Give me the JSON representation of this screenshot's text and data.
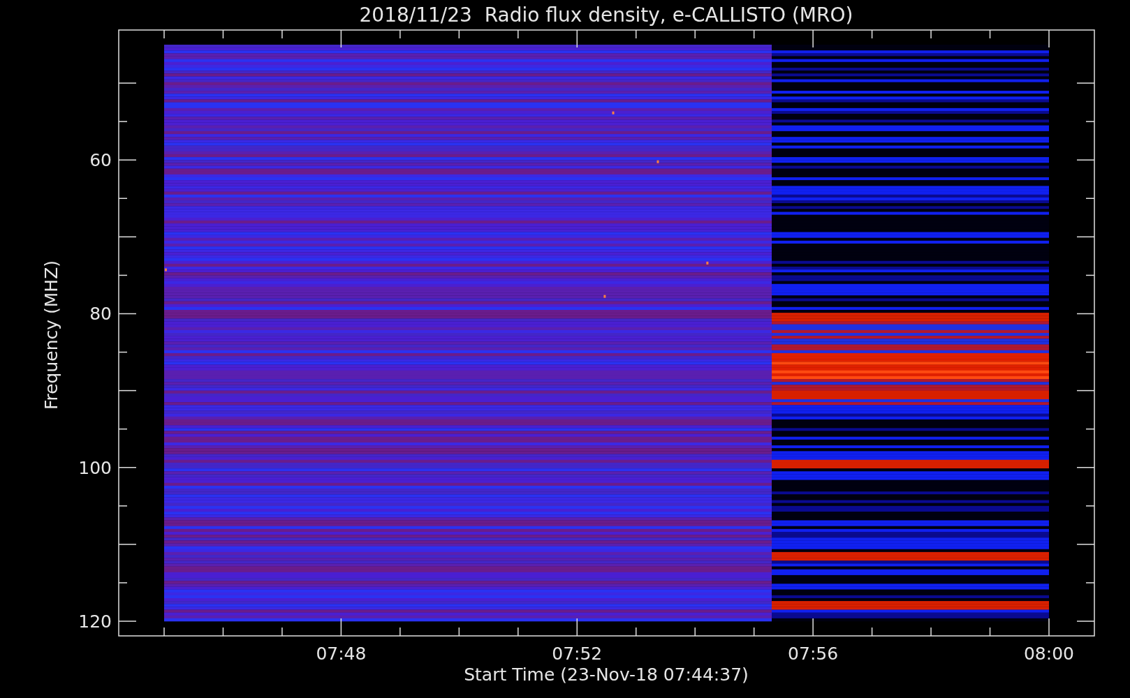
{
  "title": "2018/11/23  Radio flux density, e-CALLISTO (MRO)",
  "y_axis": {
    "label": "Frequency (MHZ)",
    "ticks": [
      "60",
      "80",
      "100",
      "120"
    ]
  },
  "x_axis": {
    "label": "Start Time (23-Nov-18 07:44:37)",
    "ticks": [
      "07:48",
      "07:52",
      "07:56",
      "08:00"
    ]
  }
}
